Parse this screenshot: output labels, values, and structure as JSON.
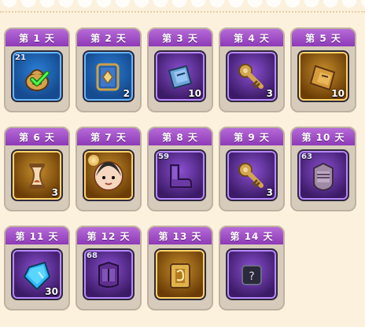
{
  "days": [
    {
      "label": "第 1 天",
      "rarity": "blue",
      "icon": "bag-icon",
      "level": "21",
      "qty": "",
      "claimed": true
    },
    {
      "label": "第 2 天",
      "rarity": "blue",
      "icon": "book-icon",
      "level": "",
      "qty": "2",
      "claimed": false
    },
    {
      "label": "第 3 天",
      "rarity": "purple",
      "icon": "ticket-icon",
      "level": "",
      "qty": "10",
      "claimed": false
    },
    {
      "label": "第 4 天",
      "rarity": "purple",
      "icon": "key-icon",
      "level": "",
      "qty": "3",
      "claimed": false
    },
    {
      "label": "第 5 天",
      "rarity": "gold",
      "icon": "scroll-icon",
      "level": "",
      "qty": "10",
      "claimed": false
    },
    {
      "label": "第 6 天",
      "rarity": "gold",
      "icon": "hourglass-icon",
      "level": "",
      "qty": "3",
      "claimed": false
    },
    {
      "label": "第 7 天",
      "rarity": "gold",
      "icon": "hero-portrait-icon",
      "level": "",
      "qty": "",
      "claimed": false
    },
    {
      "label": "第 8 天",
      "rarity": "purple",
      "icon": "boots-icon",
      "level": "59",
      "qty": "",
      "claimed": false
    },
    {
      "label": "第 9 天",
      "rarity": "purple",
      "icon": "key-icon",
      "level": "",
      "qty": "3",
      "claimed": false
    },
    {
      "label": "第 10 天",
      "rarity": "purple",
      "icon": "armor-icon",
      "level": "63",
      "qty": "",
      "claimed": false
    },
    {
      "label": "第 11 天",
      "rarity": "purple",
      "icon": "gem-icon",
      "level": "",
      "qty": "30",
      "claimed": false
    },
    {
      "label": "第 12 天",
      "rarity": "purple",
      "icon": "chest-armor-icon",
      "level": "68",
      "qty": "",
      "claimed": false
    },
    {
      "label": "第 13 天",
      "rarity": "gold",
      "icon": "card-icon",
      "level": "",
      "qty": "",
      "claimed": false
    },
    {
      "label": "第 14 天",
      "rarity": "purple",
      "icon": "mystery-item-icon",
      "level": "",
      "qty": "",
      "claimed": false
    }
  ]
}
